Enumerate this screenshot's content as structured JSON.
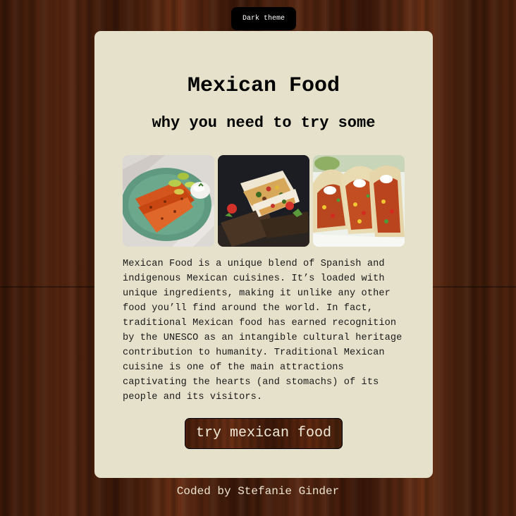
{
  "theme_toggle": {
    "label": "Dark theme"
  },
  "card": {
    "title": "Mexican Food",
    "subtitle": "why you need to try some",
    "images": [
      {
        "icon": "enchiladas-photo"
      },
      {
        "icon": "burrito-photo"
      },
      {
        "icon": "tacos-photo"
      }
    ],
    "description": "Mexican Food is a unique blend of Spanish and indigenous Mexican cuisines. It’s loaded with unique ingredients, making it unlike any other food you’ll find around the world. In fact, traditional Mexican food has earned recognition by the UNESCO as an intangible cultural heritage contribution to humanity. Traditional Mexican cuisine is one of the main attractions captivating the hearts (and stomachs) of its people and its visitors.",
    "cta_label": "try mexican food"
  },
  "footer": {
    "credit": "Coded by Stefanie Ginder"
  },
  "colors": {
    "card_background": "#e5e1cb",
    "theme_button": "#000000",
    "footer_text": "#ece4d0"
  }
}
